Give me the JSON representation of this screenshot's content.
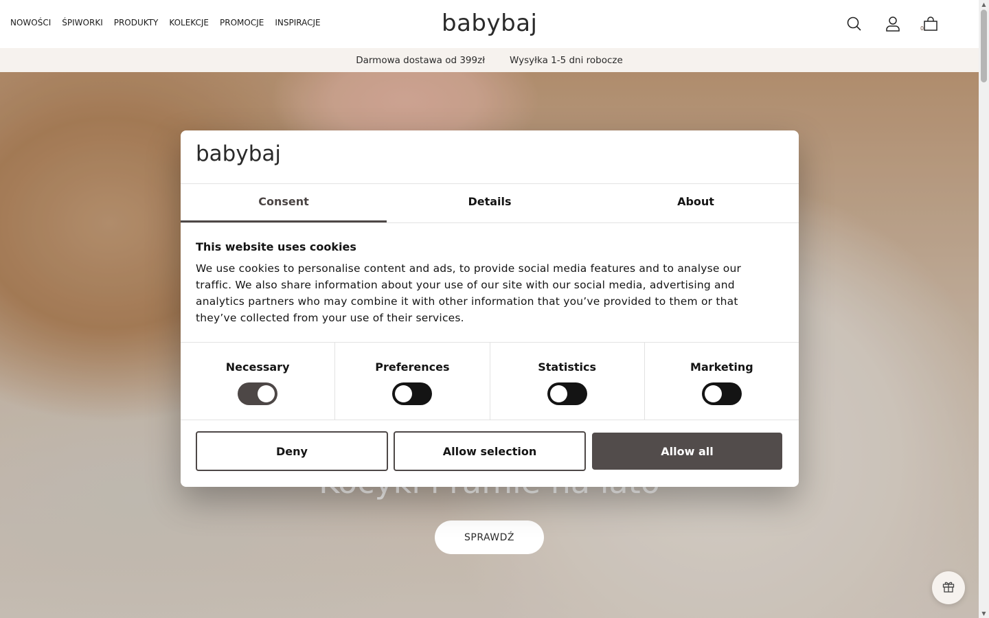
{
  "header": {
    "nav": [
      "NOWOŚCI",
      "ŚPIWORKI",
      "PRODUKTY",
      "KOLEKCJE",
      "PROMOCJE",
      "INSPIRACJE"
    ],
    "logo": "babybaj",
    "icons": [
      "search-icon",
      "user-icon",
      "cart-icon"
    ],
    "cart_count": "0"
  },
  "shipbar": {
    "free_shipping": "Darmowa dostawa od 399zł",
    "dispatch": "Wysyłka 1-5 dni robocze"
  },
  "hero": {
    "headline": "Kocyki i ramie na lato",
    "cta": "SPRAWDŹ"
  },
  "cookie_dialog": {
    "logo": "babybaj",
    "tabs": [
      "Consent",
      "Details",
      "About"
    ],
    "active_tab": "Consent",
    "title": "This website uses cookies",
    "text": "We use cookies to personalise content and ads, to provide social media features and to analyse our traffic. We also share information about your use of our site with our social media, advertising and analytics partners who may combine it with other information that you’ve provided to them or that they’ve collected from your use of their services.",
    "categories": [
      {
        "label": "Necessary",
        "enabled": true
      },
      {
        "label": "Preferences",
        "enabled": false
      },
      {
        "label": "Statistics",
        "enabled": false
      },
      {
        "label": "Marketing",
        "enabled": false
      }
    ],
    "buttons": {
      "deny": "Deny",
      "allow_selection": "Allow selection",
      "allow_all": "Allow all"
    }
  },
  "floating": {
    "icon": "gift-icon"
  },
  "colors": {
    "accent": "#4d4746",
    "shipbar_bg": "#f6f2ee"
  }
}
